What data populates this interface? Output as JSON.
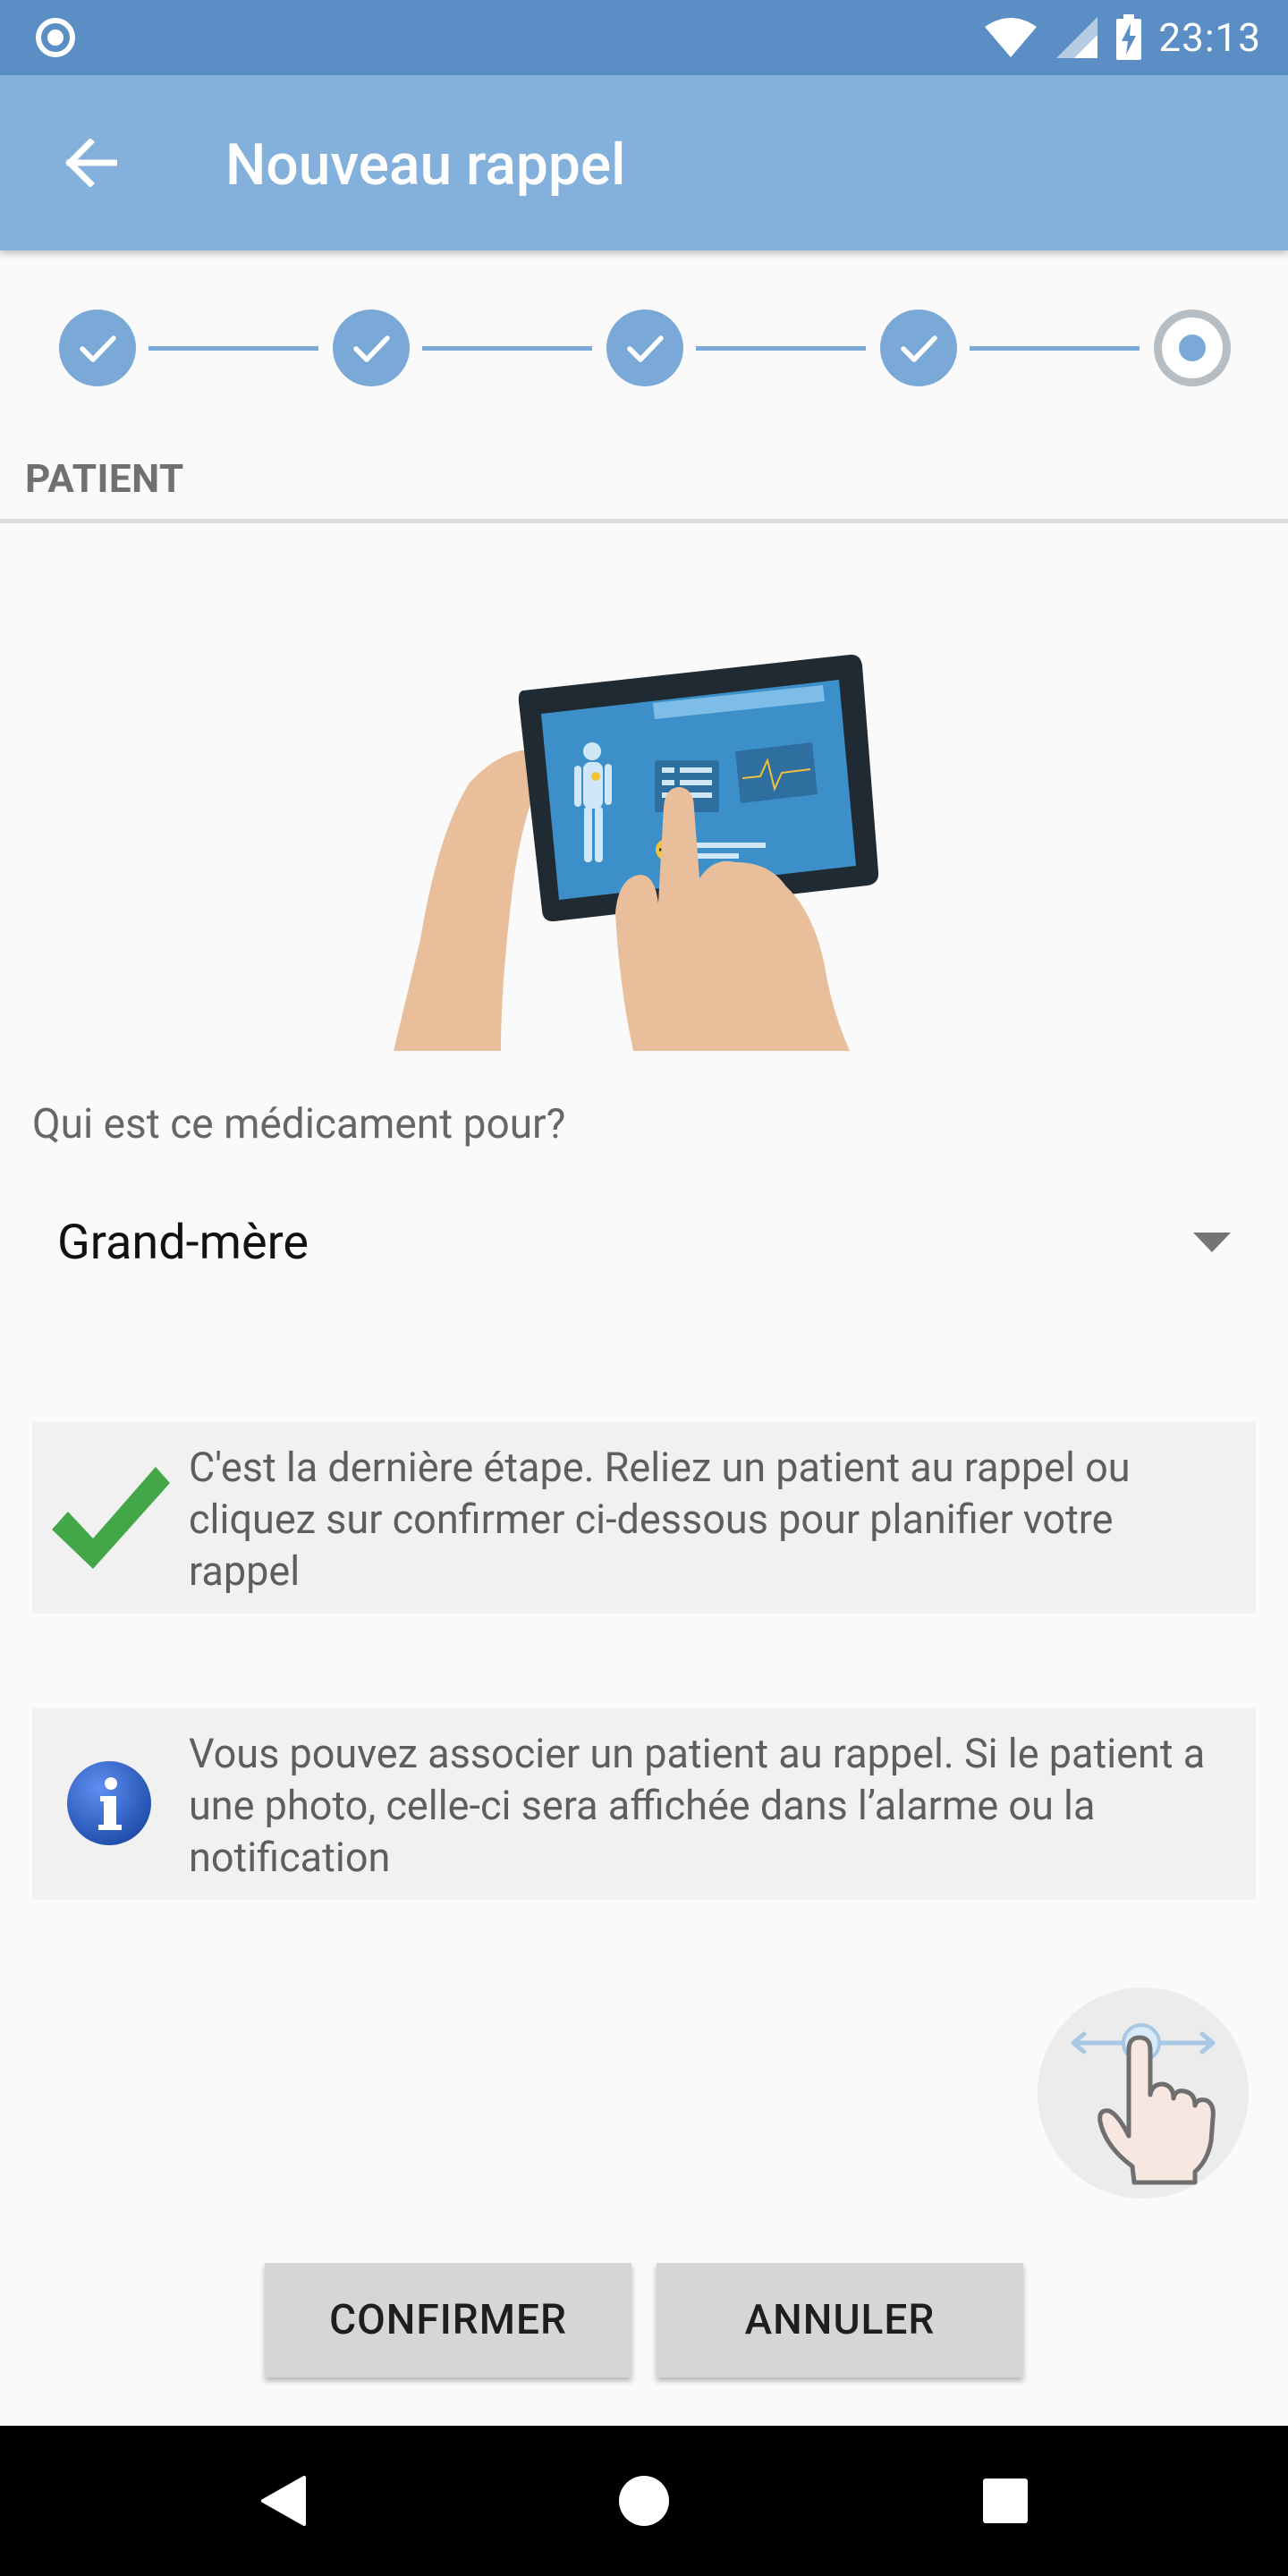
{
  "status_bar": {
    "time": "23:13",
    "icons": [
      "radio-icon",
      "wifi-icon",
      "signal-icon",
      "battery-charging-icon"
    ]
  },
  "app_bar": {
    "title": "Nouveau rappel",
    "back_icon": "arrow-back-icon"
  },
  "stepper": {
    "steps": [
      {
        "state": "done"
      },
      {
        "state": "done"
      },
      {
        "state": "done"
      },
      {
        "state": "done"
      },
      {
        "state": "current"
      }
    ],
    "color": "#7aa9d8"
  },
  "section": {
    "title": "PATIENT"
  },
  "form": {
    "question": "Qui est ce médicament pour?",
    "patient_select": {
      "selected": "Grand-mère"
    }
  },
  "cards": {
    "success": {
      "icon": "checkmark-icon",
      "text": "C'est la dernière étape. Reliez un patient au rappel ou cliquez sur confirmer ci-dessous pour planifier votre rappel",
      "color": "#43a747"
    },
    "info": {
      "icon": "info-icon",
      "text": "Vous pouvez associer un patient au rappel. Si le patient a une photo, celle-ci sera affichée dans l’alarme ou la notification",
      "color": "#2f66c8"
    }
  },
  "actions": {
    "confirm": "CONFIRMER",
    "cancel": "ANNULER"
  },
  "nav_bar": {
    "icons": [
      "nav-back-icon",
      "nav-home-icon",
      "nav-recent-icon"
    ]
  },
  "colors": {
    "status_bar": "#5b8ec4",
    "app_bar": "#84b1dc",
    "background": "#fafafa"
  }
}
